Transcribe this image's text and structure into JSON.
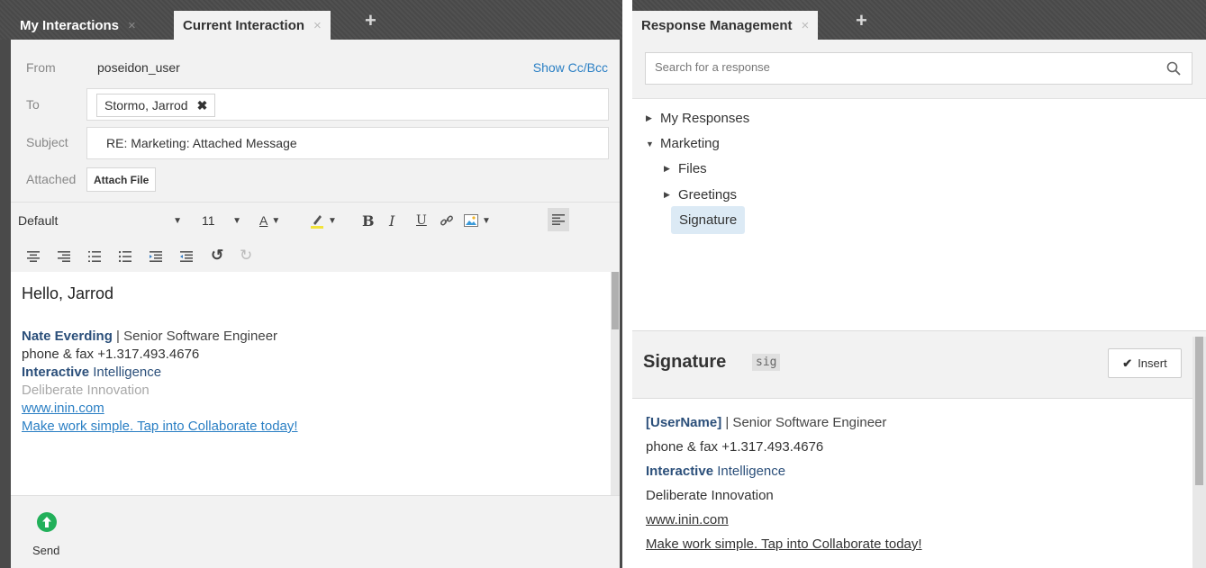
{
  "left_tabs": [
    {
      "label": "My Interactions",
      "close": "×"
    },
    {
      "label": "Current Interaction",
      "close": "×"
    }
  ],
  "add_tab": "+",
  "compose": {
    "from_label": "From",
    "from_value": "poseidon_user",
    "show_cc": "Show Cc/Bcc",
    "to_label": "To",
    "to_recipient": "Stormo, Jarrod",
    "remove_recipient": "✖",
    "subject_label": "Subject",
    "subject_value": "RE: Marketing: Attached Message",
    "attached_label": "Attached",
    "attach_button": "Attach File"
  },
  "toolbar": {
    "font_family": "Default",
    "font_size": "11",
    "font_color": "A",
    "bold": "B",
    "italic": "I",
    "underline": "U"
  },
  "body": {
    "greeting": "Hello, Jarrod",
    "name": "Nate Everding",
    "title_suffix": " | Senior Software Engineer",
    "phone": "phone & fax +1.317.493.4676",
    "company_a": "Interactive",
    "company_b": " Intelligence",
    "tagline": "Deliberate Innovation",
    "website": "www.inin.com",
    "promo": "Make work simple. Tap into Collaborate today!"
  },
  "send_label": "Send",
  "right_tabs": [
    {
      "label": "Response Management",
      "close": "×"
    }
  ],
  "search": {
    "placeholder": "Search for a response"
  },
  "tree": {
    "my_responses": "My Responses",
    "marketing": "Marketing",
    "files": "Files",
    "greetings": "Greetings",
    "signature": "Signature"
  },
  "detail": {
    "title": "Signature",
    "code": "sig",
    "insert": "Insert"
  },
  "preview": {
    "user": "[UserName]",
    "title_suffix": " | Senior Software Engineer",
    "phone": "phone & fax +1.317.493.4676",
    "company_a": "Interactive",
    "company_b": " Intelligence",
    "tagline": "Deliberate Innovation",
    "website": "www.inin.com",
    "promo": "Make work simple. Tap into Collaborate today!"
  },
  "colors": {
    "accent_link": "#2a7fc4",
    "send_green": "#22b05a",
    "signature_blue": "#2b4f7a",
    "tab_bar": "#4b4b4b"
  }
}
